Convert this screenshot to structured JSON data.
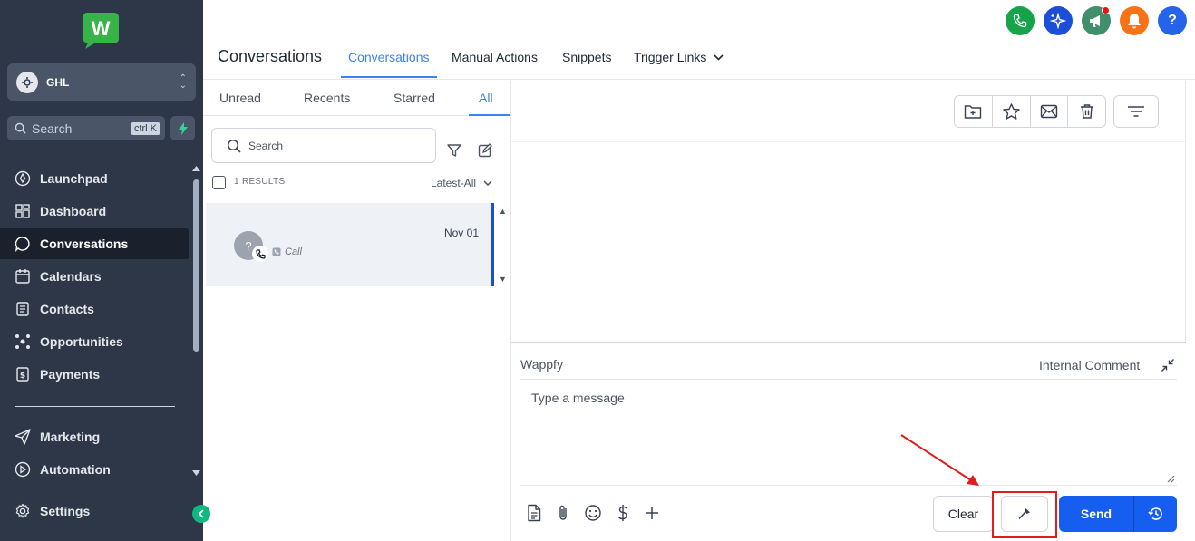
{
  "sidebar": {
    "logo_letter": "W",
    "account_name": "GHL",
    "search_placeholder": "Search",
    "search_shortcut": "ctrl K",
    "items": [
      {
        "label": "Launchpad",
        "icon": "rocket-icon"
      },
      {
        "label": "Dashboard",
        "icon": "grid-icon"
      },
      {
        "label": "Conversations",
        "icon": "chat-bubble-icon"
      },
      {
        "label": "Calendars",
        "icon": "calendar-icon"
      },
      {
        "label": "Contacts",
        "icon": "address-book-icon"
      },
      {
        "label": "Opportunities",
        "icon": "opportunities-icon"
      },
      {
        "label": "Payments",
        "icon": "payments-icon"
      }
    ],
    "items2": [
      {
        "label": "Marketing",
        "icon": "paper-plane-icon"
      },
      {
        "label": "Automation",
        "icon": "automation-icon"
      },
      {
        "label": "Settings",
        "icon": "gear-icon"
      }
    ]
  },
  "header": {
    "title": "Conversations",
    "tabs": [
      {
        "label": "Conversations"
      },
      {
        "label": "Manual Actions"
      },
      {
        "label": "Snippets"
      },
      {
        "label": "Trigger Links"
      }
    ],
    "top_icons": [
      {
        "name": "phone-icon",
        "color": "#16a34a"
      },
      {
        "name": "ai-sparkle-icon",
        "color": "#1d4ed8"
      },
      {
        "name": "megaphone-icon",
        "color": "#3f8f6a"
      },
      {
        "name": "bell-icon",
        "color": "#f97316"
      },
      {
        "name": "help-icon",
        "color": "#2563eb"
      }
    ]
  },
  "list": {
    "subtabs": [
      {
        "label": "Unread"
      },
      {
        "label": "Recents"
      },
      {
        "label": "Starred"
      },
      {
        "label": "All"
      }
    ],
    "search_placeholder": "Search",
    "results_label": "1 RESULTS",
    "sort_label": "Latest-All",
    "conversations": [
      {
        "avatar": "?",
        "date": "Nov 01",
        "type": "Call"
      }
    ]
  },
  "composer": {
    "channel": "Wappfy",
    "internal_comment": "Internal Comment",
    "message_placeholder": "Type a message",
    "clear_label": "Clear",
    "send_label": "Send"
  },
  "colors": {
    "sidebar_bg": "#2d3748",
    "accent": "#3b82f6",
    "send": "#155eef",
    "highlight": "#e11d1d"
  }
}
